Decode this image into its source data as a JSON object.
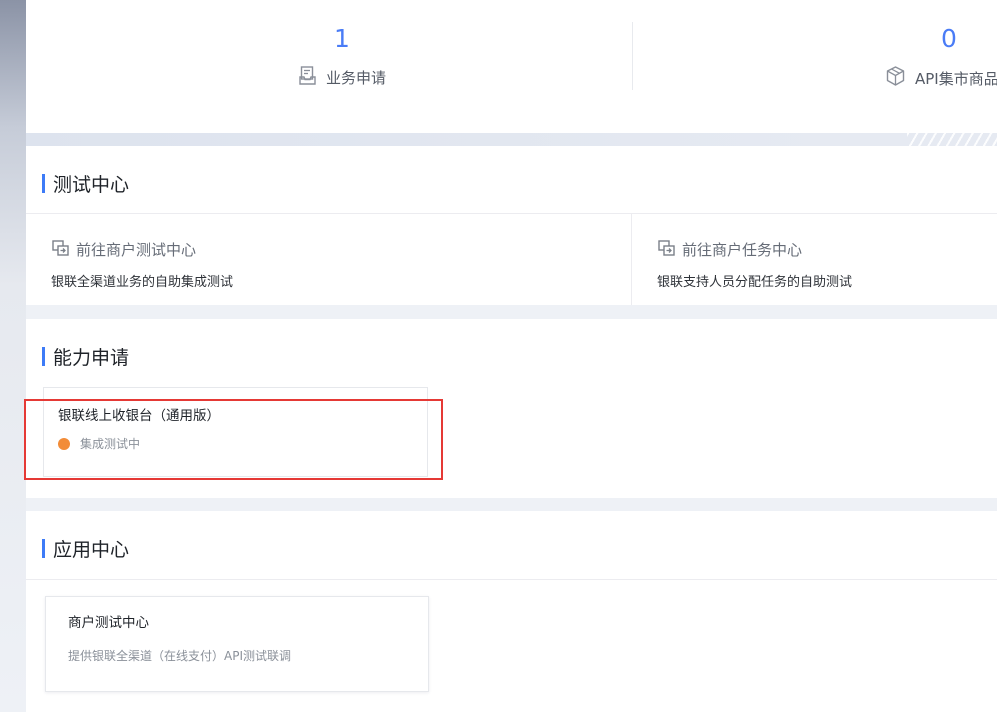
{
  "stats": [
    {
      "value": "1",
      "label": "业务申请",
      "icon": "document-tray-icon"
    },
    {
      "value": "0",
      "label": "API集市商品",
      "icon": "package-box-icon"
    }
  ],
  "test_center": {
    "title": "测试中心",
    "items": [
      {
        "link": "前往商户测试中心",
        "desc": "银联全渠道业务的自助集成测试",
        "icon": "redirect-icon"
      },
      {
        "link": "前往商户任务中心",
        "desc": "银联支持人员分配任务的自助测试",
        "icon": "redirect-icon"
      }
    ]
  },
  "ability_apply": {
    "title": "能力申请",
    "card": {
      "name": "银联线上收银台（通用版）",
      "status": "集成测试中",
      "status_color": "#f28c38"
    }
  },
  "app_center": {
    "title": "应用中心",
    "card": {
      "name": "商户测试中心",
      "desc": "提供银联全渠道（在线支付）API测试联调"
    }
  },
  "colors": {
    "accent": "#3d7bf7",
    "number": "#4a7cf6",
    "highlight": "#e53935"
  }
}
